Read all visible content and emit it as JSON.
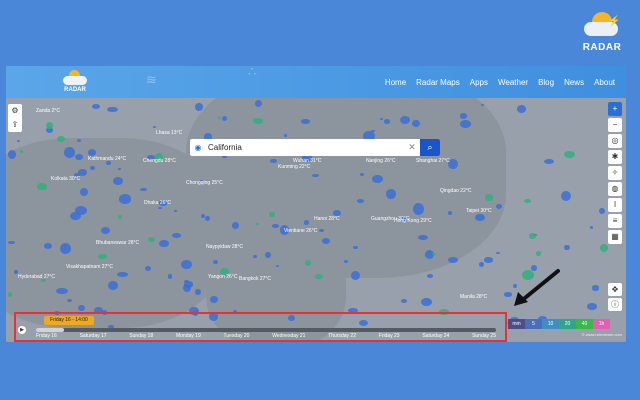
{
  "brand": {
    "label": "RADAR"
  },
  "navbar": {
    "logo_text": "RADAR",
    "links": [
      "Home",
      "Radar Maps",
      "Apps",
      "Weather",
      "Blog",
      "News",
      "About"
    ]
  },
  "search": {
    "value": "California"
  },
  "timeline": {
    "current": "Friday 16 - 14:00",
    "progress": 0.06,
    "days": [
      "Friday 16",
      "Saturday 17",
      "Sunday 18",
      "Monday 19",
      "Tuesday 20",
      "Wednesday 21",
      "Thursday 22",
      "Friday 23",
      "Saturday 24",
      "Sunday 25"
    ]
  },
  "legend": {
    "labels": [
      "mm",
      "5",
      "10",
      "20",
      "40",
      "1h"
    ],
    "colors": [
      "#4b4f86",
      "#4a6fb8",
      "#3e8fc0",
      "#2fa58a",
      "#3bb84a",
      "#e65db3"
    ]
  },
  "credit": "© www.rainviewer.com",
  "cities": [
    {
      "n": "Zanda",
      "t": "2°C"
    },
    {
      "n": "Kathmandu",
      "t": "24°C"
    },
    {
      "n": "Lhasa",
      "t": "13°C"
    },
    {
      "n": "Chengdu",
      "t": "28°C"
    },
    {
      "n": "Chongqing",
      "t": "25°C"
    },
    {
      "n": "Wuhan",
      "t": "31°C"
    },
    {
      "n": "Nanjing",
      "t": "26°C"
    },
    {
      "n": "Shanghai",
      "t": "27°C"
    },
    {
      "n": "Kolkata",
      "t": "30°C"
    },
    {
      "n": "Dhaka",
      "t": "26°C"
    },
    {
      "n": "Hanoi",
      "t": "28°C"
    },
    {
      "n": "Guangzhou",
      "t": "30°C"
    },
    {
      "n": "Hong Kong",
      "t": "29°C"
    },
    {
      "n": "Taipei",
      "t": "30°C"
    },
    {
      "n": "Bhubaneswar",
      "t": "28°C"
    },
    {
      "n": "Visakhapatnam",
      "t": "27°C"
    },
    {
      "n": "Hyderabad",
      "t": "27°C"
    },
    {
      "n": "Yangon",
      "t": "26°C"
    },
    {
      "n": "Bangkok",
      "t": "27°C"
    },
    {
      "n": "Manila",
      "t": "28°C"
    },
    {
      "n": "Naypyidaw",
      "t": "28°C"
    },
    {
      "n": "Kunming",
      "t": "22°C"
    },
    {
      "n": "Vientiane",
      "t": "26°C"
    },
    {
      "n": "Qingdao",
      "t": "22°C"
    }
  ]
}
